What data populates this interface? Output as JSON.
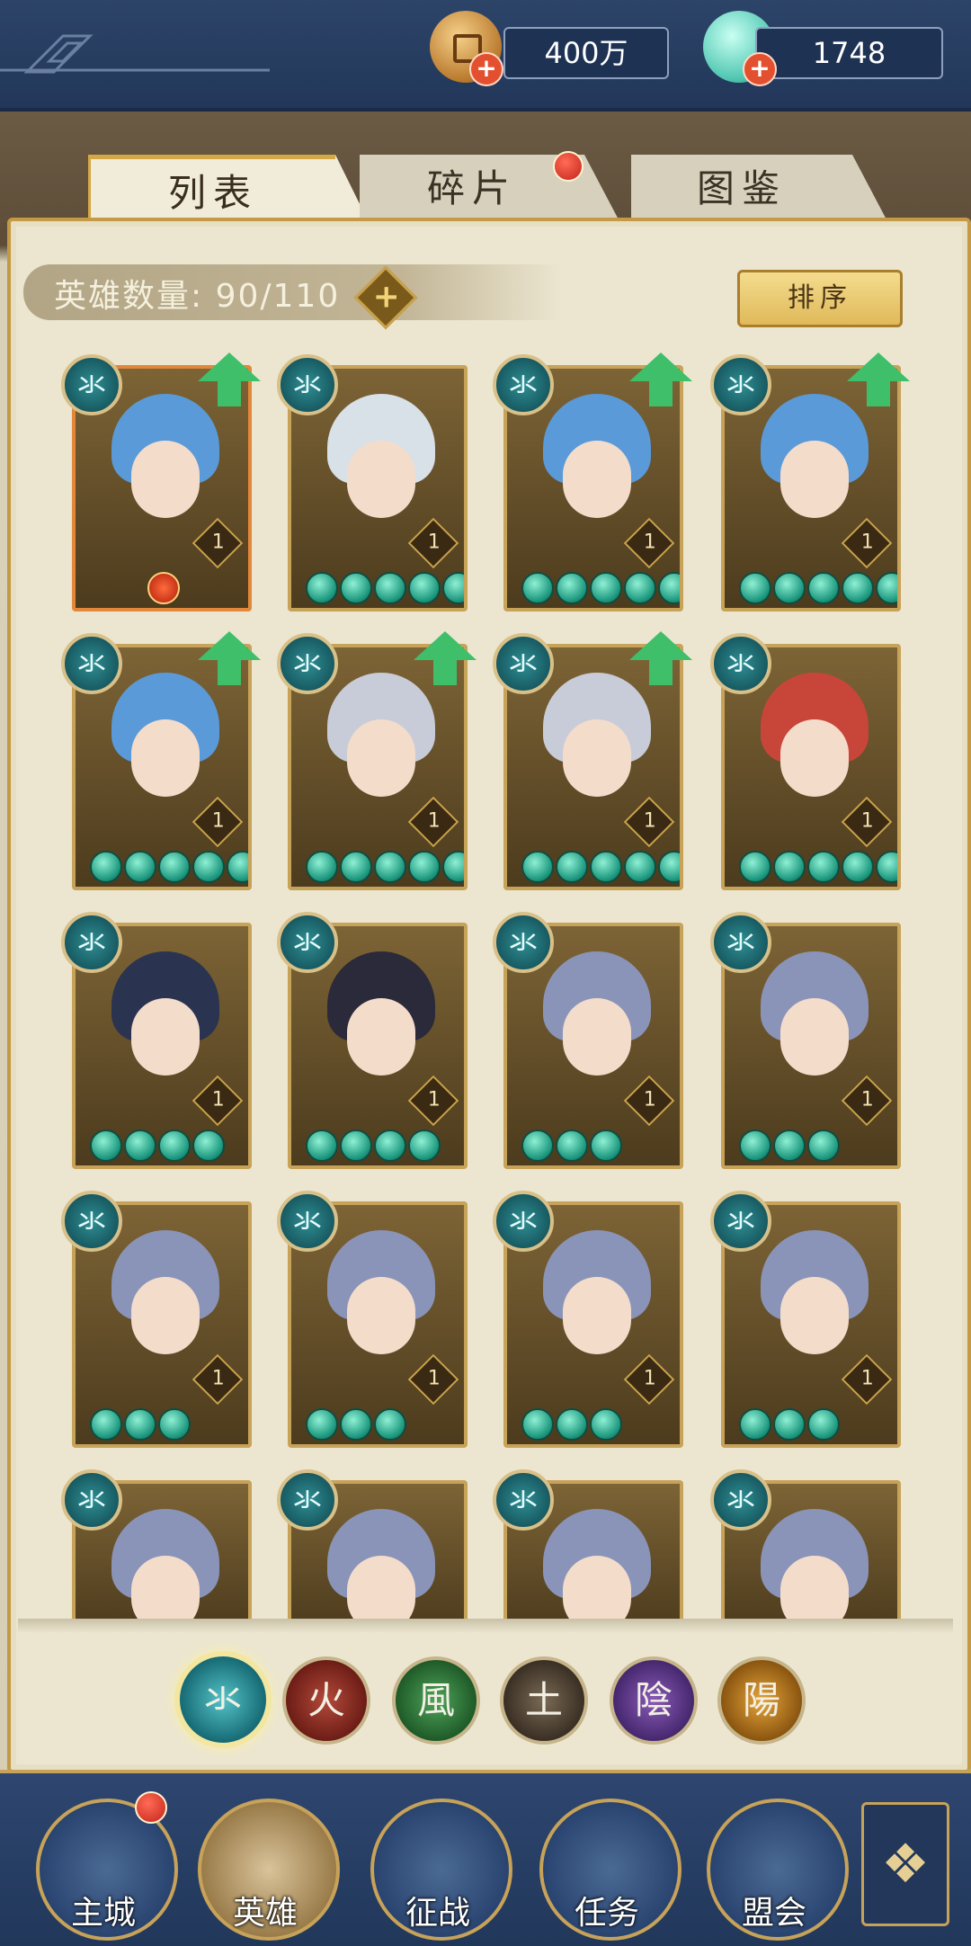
{
  "header": {
    "coins": "400万",
    "jade": "1748"
  },
  "tabs": [
    {
      "label": "列表"
    },
    {
      "label": "碎片"
    },
    {
      "label": "图鉴"
    }
  ],
  "hero_count": {
    "label": "英雄数量: 90/110"
  },
  "sort_button": "排序",
  "heroes": [
    {
      "element": "氺",
      "level": "1",
      "stars": 0,
      "upgrade": true,
      "selected": true
    },
    {
      "element": "氺",
      "level": "1",
      "stars": 5,
      "upgrade": false
    },
    {
      "element": "氺",
      "level": "1",
      "stars": 5,
      "upgrade": true
    },
    {
      "element": "氺",
      "level": "1",
      "stars": 5,
      "upgrade": true
    },
    {
      "element": "氺",
      "level": "1",
      "stars": 5,
      "upgrade": true
    },
    {
      "element": "氺",
      "level": "1",
      "stars": 5,
      "upgrade": true
    },
    {
      "element": "氺",
      "level": "1",
      "stars": 5,
      "upgrade": true
    },
    {
      "element": "氺",
      "level": "1",
      "stars": 5,
      "upgrade": false
    },
    {
      "element": "氺",
      "level": "1",
      "stars": 4,
      "upgrade": false
    },
    {
      "element": "氺",
      "level": "1",
      "stars": 4,
      "upgrade": false
    },
    {
      "element": "氺",
      "level": "1",
      "stars": 3,
      "upgrade": false
    },
    {
      "element": "氺",
      "level": "1",
      "stars": 3,
      "upgrade": false
    },
    {
      "element": "氺",
      "level": "1",
      "stars": 3,
      "upgrade": false
    },
    {
      "element": "氺",
      "level": "1",
      "stars": 3,
      "upgrade": false
    },
    {
      "element": "氺",
      "level": "1",
      "stars": 3,
      "upgrade": false
    },
    {
      "element": "氺",
      "level": "1",
      "stars": 3,
      "upgrade": false
    },
    {
      "element": "氺",
      "level": "",
      "stars": 0,
      "upgrade": false
    },
    {
      "element": "氺",
      "level": "",
      "stars": 0,
      "upgrade": false
    },
    {
      "element": "氺",
      "level": "",
      "stars": 0,
      "upgrade": false
    },
    {
      "element": "氺",
      "level": "",
      "stars": 0,
      "upgrade": false
    }
  ],
  "filters": [
    "氺",
    "火",
    "風",
    "土",
    "陰",
    "陽"
  ],
  "nav": {
    "main": "主城",
    "hero": "英雄",
    "battle": "征战",
    "task": "任务",
    "guild": "盟会"
  }
}
